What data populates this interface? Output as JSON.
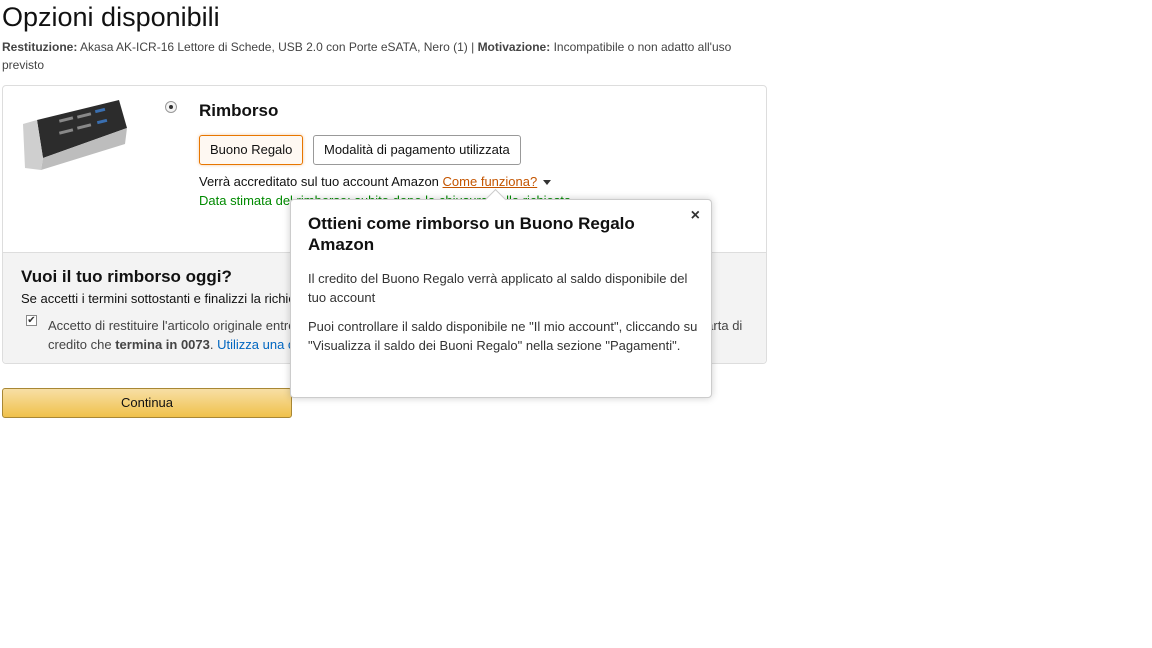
{
  "page": {
    "title": "Opzioni disponibili",
    "return_label": "Restituzione:",
    "return_item": "Akasa AK-ICR-16 Lettore di Schede, USB 2.0 con Porte eSATA, Nero (1) |",
    "reason_label": "Motivazione:",
    "reason_text": "Incompatibile o non adatto all'uso previsto"
  },
  "option": {
    "title": "Rimborso",
    "buttons": [
      "Buono Regalo",
      "Modalità di pagamento utilizzata"
    ],
    "credited_text": "Verrà accreditato sul tuo account Amazon",
    "how_link": "Come funziona?",
    "estimated_text": "Data stimata del rimborso: subito dopo la chiusura della richiesta"
  },
  "refund_today": {
    "title": "Vuoi il tuo rimborso oggi?",
    "subtitle": "Se accetti i termini sottostanti e finalizzi la richiesta",
    "accept_text": "Accetto di restituire l'articolo originale entro 30 giorni. In caso contrario, verrà addebitato il costo dell'articolo sulla carta di credito che",
    "card_bold": "termina in 0073",
    "card_link": "Utilizza una carta di credito diversa"
  },
  "continue_label": "Continua",
  "popover": {
    "title": "Ottieni come rimborso un Buono Regalo Amazon",
    "close": "×",
    "p1": "Il credito del Buono Regalo verrà applicato al saldo disponibile del tuo account",
    "p2": "Puoi controllare il saldo disponibile ne \"Il mio account\", cliccando su \"Visualizza il saldo dei Buoni Regalo\" nella sezione \"Pagamenti\"."
  }
}
